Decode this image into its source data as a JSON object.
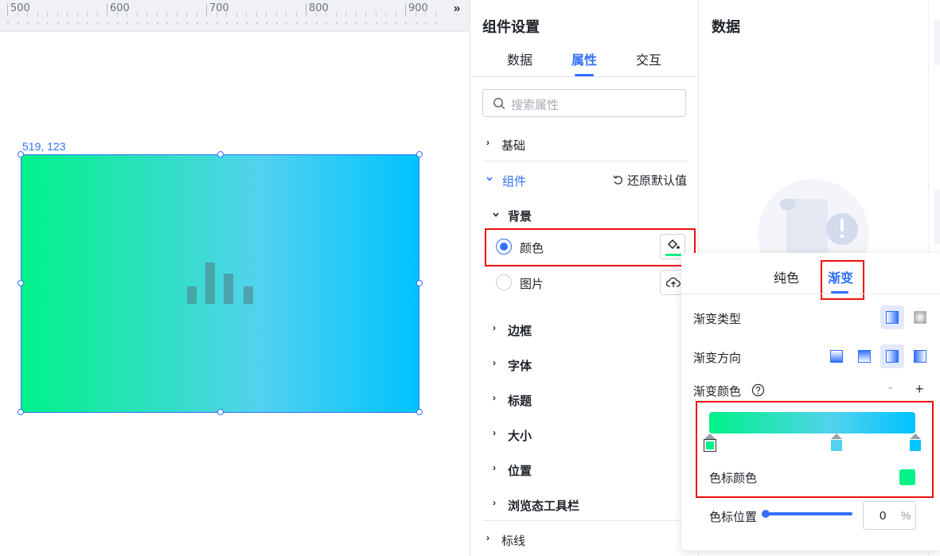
{
  "ruler": {
    "labels": [
      "500",
      "600",
      "700",
      "800",
      "900"
    ],
    "collapse_icon": "double-chevron-right-icon"
  },
  "canvas": {
    "coordinate_readout": "519, 123",
    "widget": {
      "gradient_colors": [
        "#00f288",
        "#52d2ee",
        "#00c3ff"
      ],
      "placeholder_icon": "bar-chart-icon"
    }
  },
  "settings": {
    "title": "组件设置",
    "tabs": [
      {
        "label": "数据"
      },
      {
        "label": "属性",
        "active": true
      },
      {
        "label": "交互"
      }
    ],
    "search_placeholder": "搜索属性",
    "sections": {
      "basic": "基础",
      "component": "组件",
      "restore": "还原默认值",
      "background": "背景",
      "bg_color": "颜色",
      "bg_image": "图片",
      "border": "边框",
      "font": "字体",
      "title": "标题",
      "size": "大小",
      "position": "位置",
      "toolbar": "浏览态工具栏",
      "markline": "标线"
    }
  },
  "data_panel": {
    "title": "数据"
  },
  "gradient_popup": {
    "tabs": [
      {
        "label": "纯色"
      },
      {
        "label": "渐变",
        "active": true
      }
    ],
    "type_label": "渐变类型",
    "direction_label": "渐变方向",
    "colors_label": "渐变颜色",
    "minus": "-",
    "plus": "+",
    "stops": [
      {
        "color": "#00f288",
        "position": 0
      },
      {
        "color": "#52d2ee",
        "position": 60
      },
      {
        "color": "#00c3ff",
        "position": 100
      }
    ],
    "stop_color_label": "色标颜色",
    "stop_color_value": "#00f288",
    "stop_position_label": "色标位置",
    "stop_position_value": "0",
    "stop_position_unit": "%"
  },
  "colors": {
    "accent": "#3370ff",
    "highlight_border": "#f00f0f"
  }
}
